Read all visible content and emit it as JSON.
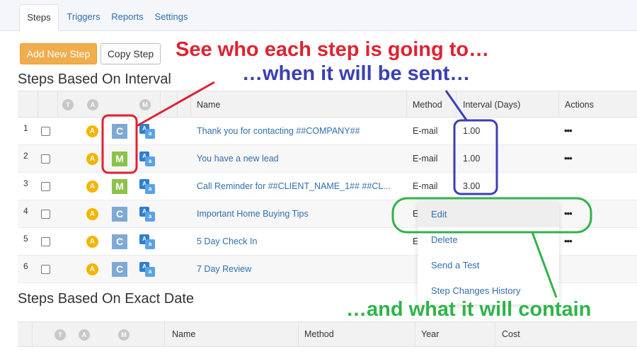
{
  "tabs": [
    {
      "label": "Steps",
      "active": true
    },
    {
      "label": "Triggers",
      "active": false
    },
    {
      "label": "Reports",
      "active": false
    },
    {
      "label": "Settings",
      "active": false
    }
  ],
  "toolbar": {
    "add_label": "Add New Step",
    "copy_label": "Copy Step"
  },
  "section_interval": {
    "title": "Steps Based On Interval",
    "headers": {
      "t": "T",
      "a": "A",
      "m": "M",
      "name": "Name",
      "method": "Method",
      "interval": "Interval (Days)",
      "actions": "Actions"
    },
    "rows": [
      {
        "num": "1",
        "type": "C",
        "name": "Thank you for contacting ##COMPANY##",
        "method": "E-mail",
        "interval": "1.00",
        "actions": "•••"
      },
      {
        "num": "2",
        "type": "M",
        "name": "You have a new lead",
        "method": "E-mail",
        "interval": "1.00",
        "actions": "•••"
      },
      {
        "num": "3",
        "type": "M",
        "name": "Call Reminder for ##CLIENT_NAME_1## ##CL...",
        "method": "E-mail",
        "interval": "3.00",
        "actions": ""
      },
      {
        "num": "4",
        "type": "C",
        "name": "Important Home Buying Tips",
        "method": "E",
        "interval": "",
        "actions": "•••"
      },
      {
        "num": "5",
        "type": "C",
        "name": "5 Day Check In",
        "method": "E",
        "interval": "",
        "actions": "•••"
      },
      {
        "num": "6",
        "type": "C",
        "name": "7 Day Review",
        "method": "",
        "interval": "",
        "actions": ""
      }
    ]
  },
  "badges": {
    "a": "A",
    "lang1": "A",
    "lang2": "a"
  },
  "dropdown": {
    "items": [
      "Edit",
      "Delete",
      "Send a Test",
      "Step Changes History"
    ]
  },
  "section_date": {
    "title": "Steps Based On Exact Date",
    "headers": {
      "t": "T",
      "a": "A",
      "m": "M",
      "name": "Name",
      "method": "Method",
      "year": "Year",
      "cost": "Cost"
    }
  },
  "annotations": {
    "who": "See who each step is going to…",
    "when": "…when it will be sent…",
    "what": "…and what it will contain"
  },
  "colors": {
    "red": "#e02230",
    "blue": "#3a3fb4",
    "green": "#2fb34a",
    "accent": "#f0ad4e",
    "link": "#2f6fb0"
  }
}
